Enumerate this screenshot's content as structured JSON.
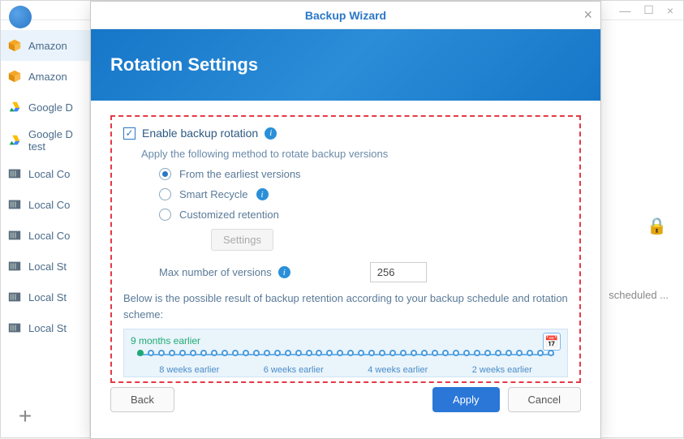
{
  "window": {
    "min": "—",
    "max": "☐",
    "close": "×"
  },
  "sidebar": {
    "items": [
      {
        "label": "Amazon ",
        "icon": "amazon"
      },
      {
        "label": "Amazon ",
        "icon": "amazon"
      },
      {
        "label": "Google D",
        "icon": "gdrive"
      },
      {
        "label": "Google D\ntest",
        "icon": "gdrive"
      },
      {
        "label": "Local Co",
        "icon": "local"
      },
      {
        "label": "Local Co",
        "icon": "local"
      },
      {
        "label": "Local Co",
        "icon": "local"
      },
      {
        "label": "Local St",
        "icon": "local"
      },
      {
        "label": "Local St",
        "icon": "local"
      },
      {
        "label": "Local St",
        "icon": "local"
      }
    ]
  },
  "bg": {
    "scheduled": "scheduled ..."
  },
  "modal": {
    "title": "Backup Wizard",
    "header": "Rotation Settings",
    "enable": {
      "checked": true,
      "label": "Enable backup rotation"
    },
    "applyText": "Apply the following method to rotate backup versions",
    "radios": {
      "earliest": {
        "label": "From the earliest versions",
        "checked": true
      },
      "smart": {
        "label": "Smart Recycle",
        "checked": false
      },
      "custom": {
        "label": "Customized retention",
        "checked": false
      }
    },
    "settingsBtn": "Settings",
    "maxVersions": {
      "label": "Max number of versions",
      "value": "256"
    },
    "explain": "Below is the possible result of backup retention according to your backup schedule and rotation scheme:",
    "timeline": {
      "start": "9 months earlier",
      "ticks": [
        "8 weeks earlier",
        "6 weeks earlier",
        "4 weeks earlier",
        "2 weeks earlier"
      ]
    },
    "buttons": {
      "back": "Back",
      "apply": "Apply",
      "cancel": "Cancel"
    }
  }
}
